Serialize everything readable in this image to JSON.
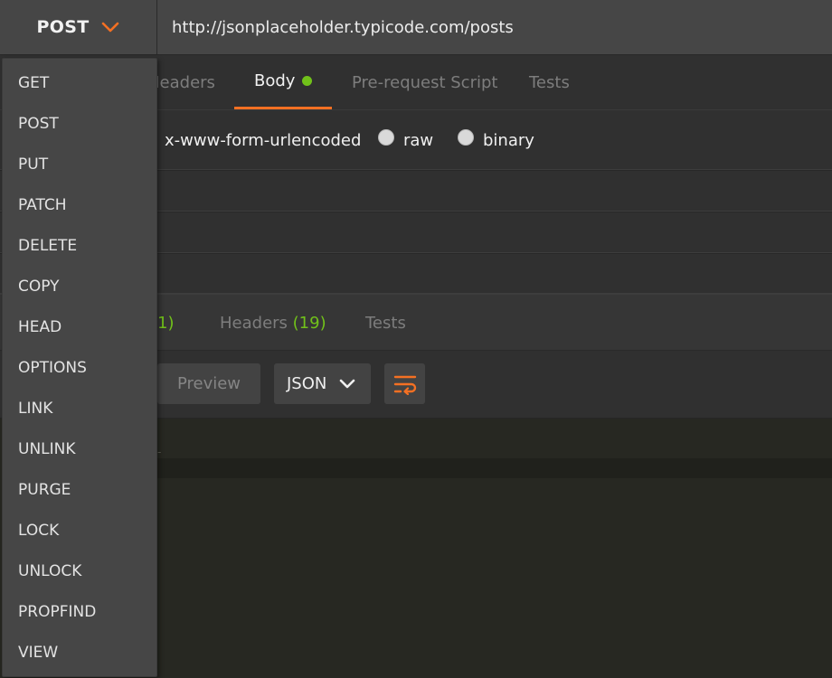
{
  "request": {
    "method": "POST",
    "url": "http://jsonplaceholder.typicode.com/posts"
  },
  "request_tabs": {
    "headers_partial": "Headers",
    "body": "Body",
    "pre_request": "Pre-request Script",
    "tests": "Tests"
  },
  "body_modes": {
    "urlencoded": "x-www-form-urlencoded",
    "raw": "raw",
    "binary": "binary"
  },
  "response_tabs": {
    "body_count_partial": "1)",
    "headers_label": "Headers",
    "headers_count": "(19)",
    "tests": "Tests"
  },
  "response_toolbar": {
    "preview": "Preview",
    "format": "JSON"
  },
  "method_menu": [
    "GET",
    "POST",
    "PUT",
    "PATCH",
    "DELETE",
    "COPY",
    "HEAD",
    "OPTIONS",
    "LINK",
    "UNLINK",
    "PURGE",
    "LOCK",
    "UNLOCK",
    "PROPFIND",
    "VIEW"
  ],
  "colors": {
    "accent": "#f47023",
    "success": "#71c11a",
    "panel": "#303030",
    "menu": "#464646"
  },
  "icons": {
    "method_chevron": "chevron-down-icon",
    "format_chevron": "chevron-down-icon",
    "wrap": "wrap-lines-icon"
  }
}
